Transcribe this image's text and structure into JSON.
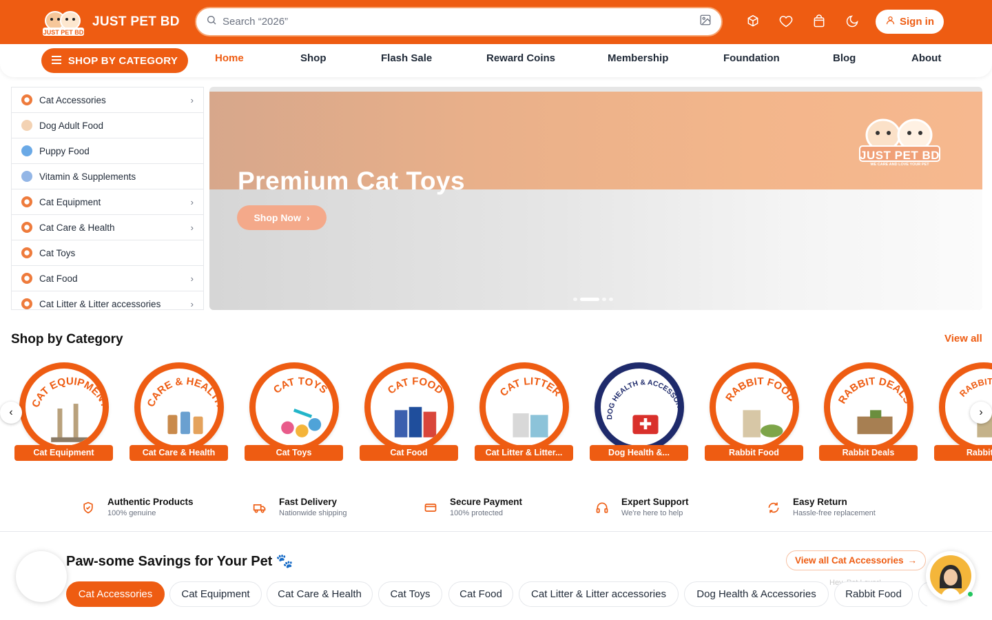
{
  "header": {
    "brand": "JUST PET BD",
    "search_placeholder": "Search “2026”",
    "signin_label": "Sign in",
    "colors": {
      "brand": "#ee5c12",
      "accent": "#f4a98a"
    }
  },
  "nav": {
    "category_button": "SHOP BY CATEGORY",
    "items": [
      "Home",
      "Shop",
      "Flash Sale",
      "Reward Coins",
      "Membership",
      "Foundation",
      "Blog",
      "About"
    ],
    "active": "Home"
  },
  "sidebar": {
    "items": [
      {
        "label": "Cat Accessories",
        "has_submenu": true
      },
      {
        "label": "Dog Adult Food",
        "has_submenu": false
      },
      {
        "label": "Puppy Food",
        "has_submenu": false
      },
      {
        "label": "Vitamin & Supplements",
        "has_submenu": false
      },
      {
        "label": "Cat Equipment",
        "has_submenu": true
      },
      {
        "label": "Cat Care & Health",
        "has_submenu": true
      },
      {
        "label": "Cat Toys",
        "has_submenu": false
      },
      {
        "label": "Cat Food",
        "has_submenu": true
      },
      {
        "label": "Cat Litter & Litter accessories",
        "has_submenu": true
      }
    ]
  },
  "banner": {
    "title": "Premium Cat Toys",
    "cta": "Shop Now",
    "logo_text": "JUST PET BD",
    "logo_tagline": "WE CARE AND LOVE YOUR PET"
  },
  "shop_by_category": {
    "title": "Shop by Category",
    "view_all": "View all",
    "items": [
      {
        "label": "Cat Equipment",
        "arc": "CAT EQUIPMENT"
      },
      {
        "label": "Cat Care & Health",
        "arc": "CARE & HEALTH"
      },
      {
        "label": "Cat Toys",
        "arc": "CAT TOYS"
      },
      {
        "label": "Cat Food",
        "arc": "CAT FOOD"
      },
      {
        "label": "Cat Litter & Litter...",
        "arc": "CAT LITTER"
      },
      {
        "label": "Dog Health &...",
        "arc": "DOG HEALTH & ACCESSORIES"
      },
      {
        "label": "Rabbit Food",
        "arc": "RABBIT FOOD"
      },
      {
        "label": "Rabbit Deals",
        "arc": "RABBIT DEALS"
      },
      {
        "label": "Rabbit...",
        "arc": "RABBIT FOOD"
      }
    ]
  },
  "features": [
    {
      "title": "Authentic Products",
      "subtitle": "100% genuine",
      "icon": "shield-icon"
    },
    {
      "title": "Fast Delivery",
      "subtitle": "Nationwide shipping",
      "icon": "truck-icon"
    },
    {
      "title": "Secure Payment",
      "subtitle": "100% protected",
      "icon": "card-icon"
    },
    {
      "title": "Expert Support",
      "subtitle": "We're here to help",
      "icon": "headphones-icon"
    },
    {
      "title": "Easy Return",
      "subtitle": "Hassle-free replacement",
      "icon": "refresh-icon"
    }
  ],
  "savings": {
    "title": "Paw-some Savings for Your Pet 🐾",
    "view_all": "View all Cat Accessories",
    "chips": [
      "Cat Accessories",
      "Cat Equipment",
      "Cat Care & Health",
      "Cat Toys",
      "Cat Food",
      "Cat Litter & Litter accessories",
      "Dog Health & Accessories",
      "Rabbit Food",
      "R"
    ],
    "active_chip": "Cat Accessories"
  },
  "chat": {
    "hint": "Hey, Pet Lover!"
  }
}
